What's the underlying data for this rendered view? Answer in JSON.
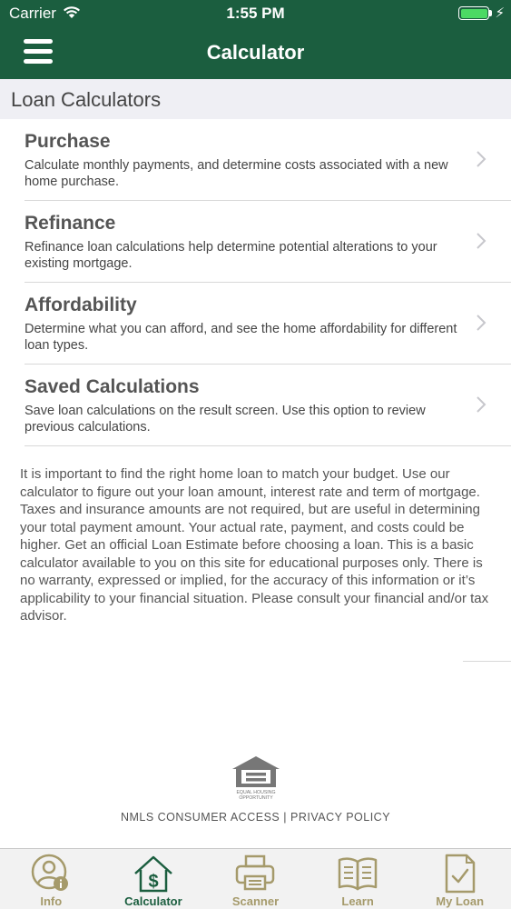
{
  "status_bar": {
    "carrier": "Carrier",
    "time": "1:55 PM"
  },
  "nav": {
    "title": "Calculator"
  },
  "section": {
    "title": "Loan Calculators"
  },
  "items": [
    {
      "title": "Purchase",
      "description": "Calculate monthly payments, and determine costs associated with a new home purchase."
    },
    {
      "title": "Refinance",
      "description": "Refinance loan calculations help determine potential alterations to your existing mortgage."
    },
    {
      "title": "Affordability",
      "description": "Determine what you can afford, and see the home affordability for different loan types."
    },
    {
      "title": "Saved Calculations",
      "description": "Save loan calculations on the result screen. Use this option to review previous calculations."
    }
  ],
  "disclaimer": "It is important to find the right home loan to match your budget. Use our calculator to figure out your loan amount, interest rate and term of mortgage. Taxes and insurance amounts are not required, but are useful in determining your total payment amount. Your actual rate, payment, and costs could be higher. Get an official Loan Estimate before choosing a loan. This is a basic calculator available to you on this site for educational purposes only. There is no warranty, expressed or implied, for the accuracy of this information or it’s applicability to your financial situation. Please consult your financial and/or tax advisor.",
  "logo": {
    "text_line1": "EQUAL HOUSING",
    "text_line2": "OPPORTUNITY"
  },
  "footer": {
    "nmls_link": "NMLS CONSUMER ACCESS",
    "separator": "|",
    "privacy_link": "PRIVACY POLICY"
  },
  "tabs": [
    {
      "label": "Info",
      "icon": "user-info-icon",
      "active": false
    },
    {
      "label": "Calculator",
      "icon": "house-dollar-icon",
      "active": true
    },
    {
      "label": "Scanner",
      "icon": "printer-icon",
      "active": false
    },
    {
      "label": "Learn",
      "icon": "open-book-icon",
      "active": false
    },
    {
      "label": "My Loan",
      "icon": "document-check-icon",
      "active": false
    }
  ],
  "colors": {
    "brand_green": "#1b5e3f",
    "tab_inactive": "#a59a6b",
    "battery_fill": "#4cd964"
  }
}
